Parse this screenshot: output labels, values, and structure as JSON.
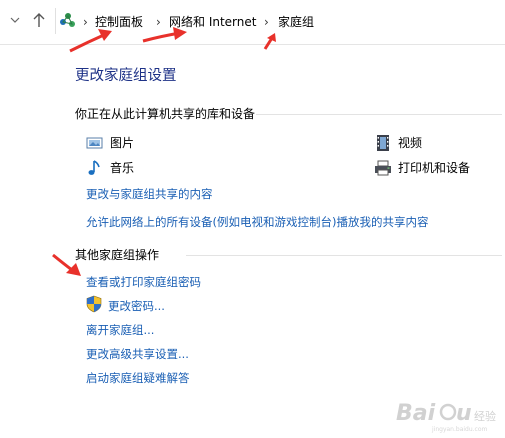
{
  "addressbar": {
    "crumbs": [
      "控制面板",
      "网络和 Internet",
      "家庭组"
    ],
    "separator": "›"
  },
  "page": {
    "title": "更改家庭组设置"
  },
  "sharing_section": {
    "heading": "你正在从此计算机共享的库和设备",
    "items": [
      {
        "label": "图片",
        "icon": "pictures-icon"
      },
      {
        "label": "视频",
        "icon": "videos-icon"
      },
      {
        "label": "音乐",
        "icon": "music-icon"
      },
      {
        "label": "打印机和设备",
        "icon": "printer-icon"
      }
    ],
    "links": [
      "更改与家庭组共享的内容",
      "允许此网络上的所有设备(例如电视和游戏控制台)播放我的共享内容"
    ]
  },
  "actions_section": {
    "heading": "其他家庭组操作",
    "links": [
      "查看或打印家庭组密码",
      "更改密码...",
      "离开家庭组...",
      "更改高级共享设置...",
      "启动家庭组疑难解答"
    ]
  },
  "colors": {
    "title": "#1e3287",
    "link": "#1a5fb4",
    "annotation_arrow": "#e8312b"
  },
  "watermark": {
    "text": "Baidu 经验"
  }
}
